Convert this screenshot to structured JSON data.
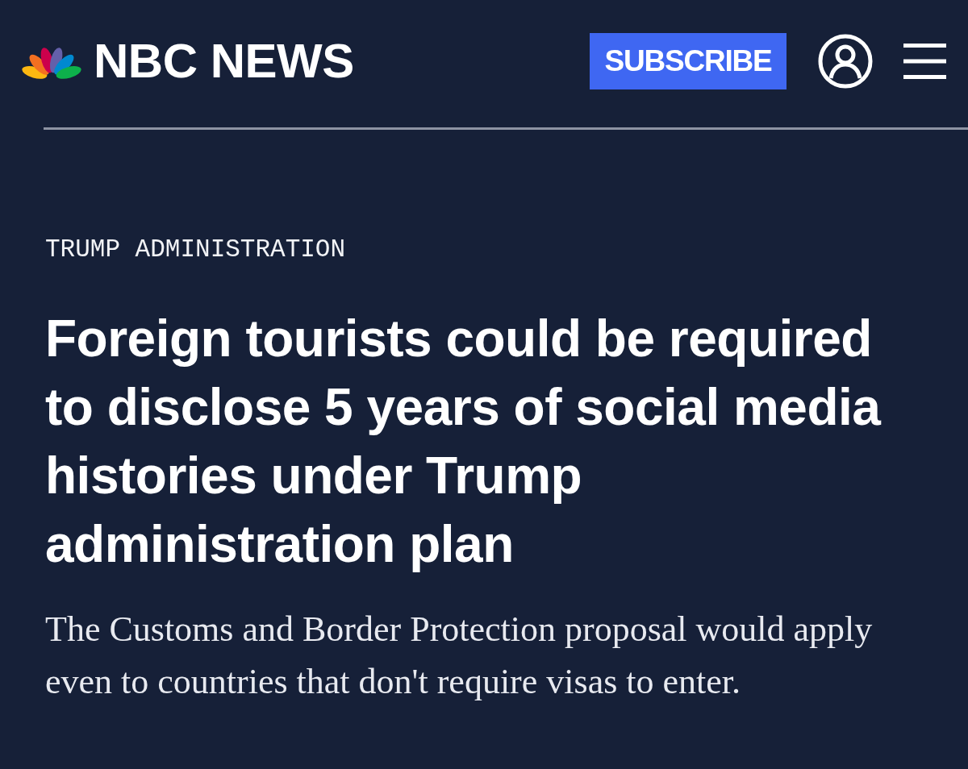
{
  "header": {
    "logo_text": "NBC NEWS",
    "subscribe_button": "SUBSCRIBE"
  },
  "article": {
    "category": "TRUMP ADMINISTRATION",
    "headline": "Foreign tourists could be required to disclose 5 years of social media histories under Trump administration plan",
    "dek": "The Customs and Border Protection proposal would apply even to countries that don't require visas to enter."
  }
}
